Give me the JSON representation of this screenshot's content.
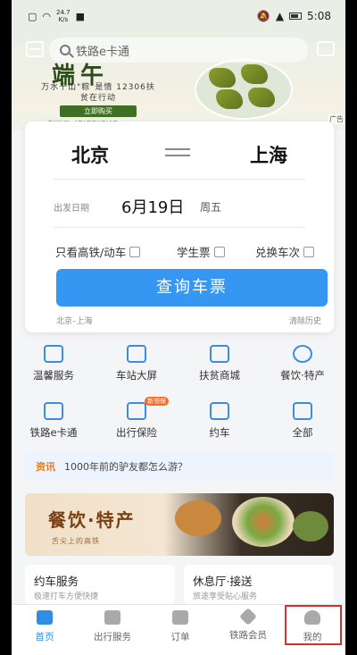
{
  "status_bar": {
    "speed": "24.7",
    "speed_unit": "K/s",
    "time": "5:08"
  },
  "banner": {
    "title": "端午",
    "subtitle": "万水千山\"粽\"是情 12306扶贫在行动",
    "button": "立即购买",
    "date": "活动时间：6月1日到6月15日",
    "ad_tag": "广告"
  },
  "search": {
    "placeholder": "铁路e卡通"
  },
  "ticket": {
    "from": "北京",
    "to": "上海",
    "date_label": "出发日期",
    "date": "6月19日",
    "weekday": "周五",
    "options": [
      "只看高铁/动车",
      "学生票",
      "兑换车次"
    ],
    "query_button": "查询车票",
    "history": "北京–上海",
    "clear_history": "清除历史"
  },
  "services": [
    {
      "label": "温馨服务",
      "icon": "heart-icon"
    },
    {
      "label": "车站大屏",
      "icon": "screen-icon"
    },
    {
      "label": "扶贫商城",
      "icon": "shop-icon"
    },
    {
      "label": "餐饮·特产",
      "icon": "bowl-icon"
    },
    {
      "label": "铁路e卡通",
      "icon": "card-icon"
    },
    {
      "label": "出行保险",
      "icon": "shield-icon",
      "badge": "新领保"
    },
    {
      "label": "约车",
      "icon": "car-icon"
    },
    {
      "label": "全部",
      "icon": "grid-icon"
    }
  ],
  "info": {
    "tag": "资讯",
    "text": "1000年前的驴友都怎么游？"
  },
  "food_banner": {
    "title": "餐饮·特产",
    "subtitle": "舌尖上的高铁"
  },
  "cards": [
    {
      "title": "约车服务",
      "subtitle": "极速打车方便快捷"
    },
    {
      "title": "休息厅·接送",
      "subtitle": "旅途享受贴心服务"
    }
  ],
  "tabs": [
    {
      "label": "首页",
      "active": true
    },
    {
      "label": "出行服务",
      "active": false
    },
    {
      "label": "订单",
      "active": false
    },
    {
      "label": "铁路会员",
      "active": false
    },
    {
      "label": "我的",
      "active": false
    }
  ],
  "colors": {
    "primary": "#3597f2",
    "tab_active": "#2f8de4",
    "highlight": "#d3302f",
    "info_tag": "#e57a1f"
  }
}
